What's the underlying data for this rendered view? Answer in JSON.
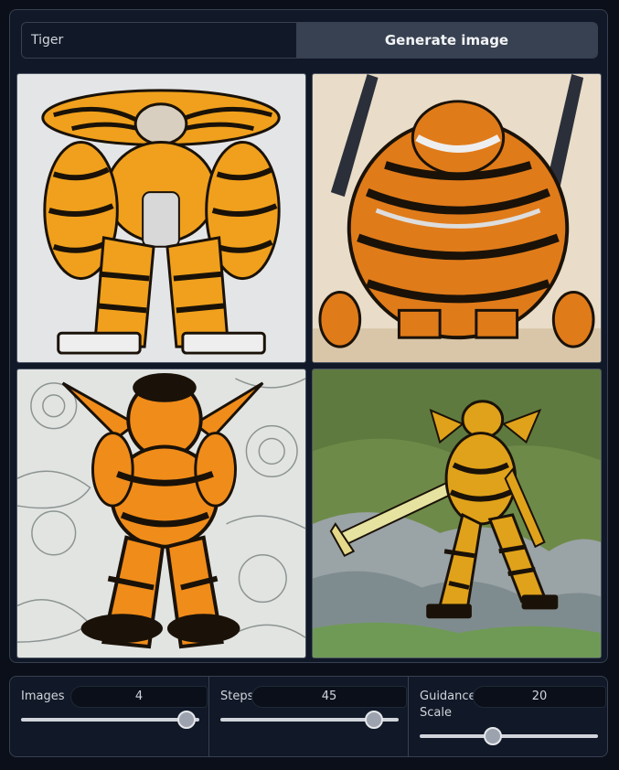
{
  "prompt": {
    "value": "Tiger",
    "placeholder": ""
  },
  "generate_button": {
    "label": "Generate image"
  },
  "gallery": {
    "images": [
      {
        "icon": "generated-image-tiger-mech-1"
      },
      {
        "icon": "generated-image-tiger-mech-2"
      },
      {
        "icon": "generated-image-tiger-mech-3"
      },
      {
        "icon": "generated-image-tiger-mech-4"
      }
    ]
  },
  "controls": {
    "images": {
      "label": "Images",
      "value": "4",
      "fraction": 0.93
    },
    "steps": {
      "label": "Steps",
      "value": "45",
      "fraction": 0.86
    },
    "guidance": {
      "label": "Guidance Scale",
      "value": "20",
      "fraction": 0.41
    }
  },
  "colors": {
    "background": "#0b0f19",
    "panel": "#111827",
    "border": "#374151",
    "tiger_orange": "#f0a01c",
    "stripe": "#1a1208"
  }
}
